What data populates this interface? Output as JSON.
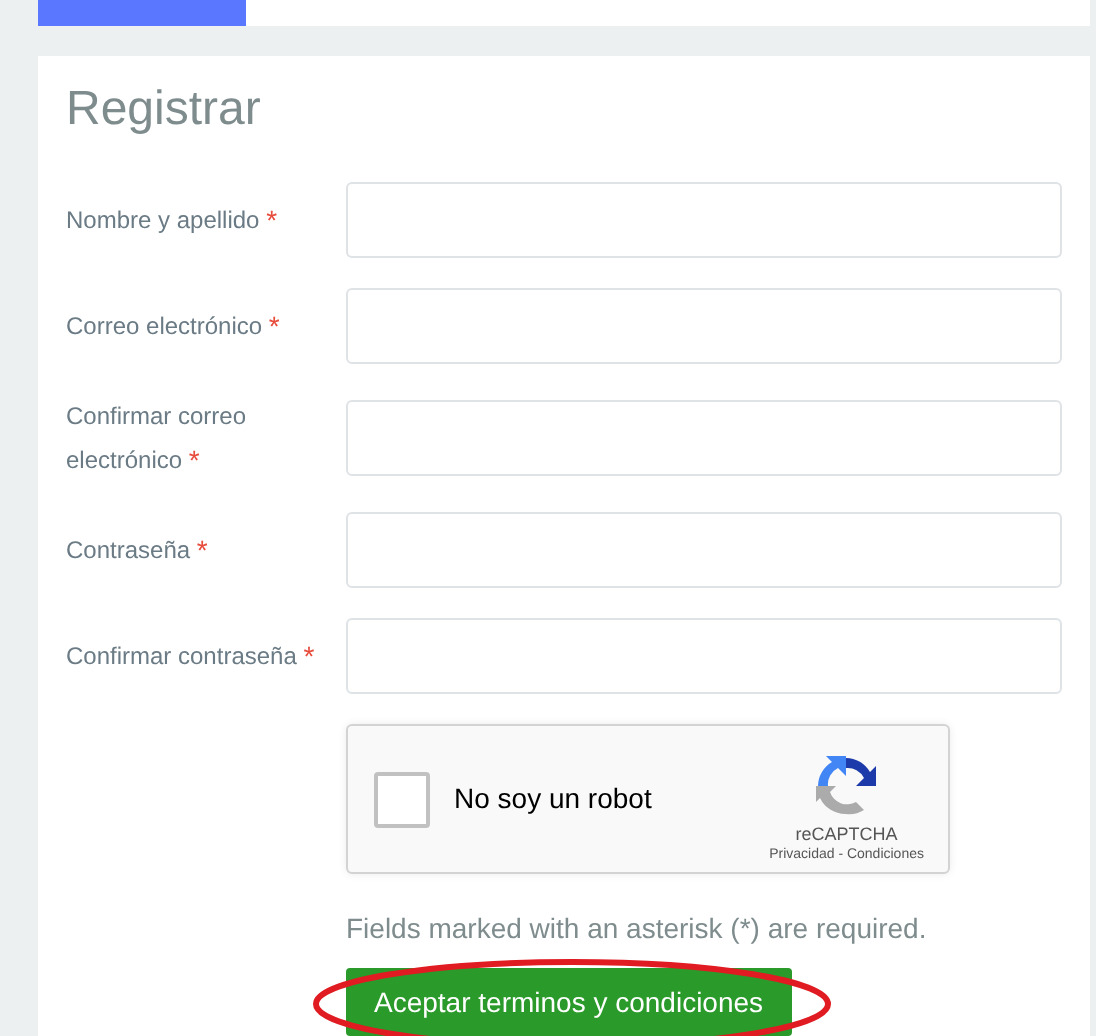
{
  "title": "Registrar",
  "fields": [
    {
      "label": "Nombre y apellido",
      "required_mark": "*"
    },
    {
      "label": "Correo electrónico",
      "required_mark": "*"
    },
    {
      "label": "Confirmar correo electrónico",
      "required_mark": "*"
    },
    {
      "label": "Contraseña",
      "required_mark": "*"
    },
    {
      "label": "Confirmar contraseña",
      "required_mark": "*"
    }
  ],
  "captcha": {
    "label": "No soy un robot",
    "checked": false,
    "brand": "reCAPTCHA",
    "links": "Privacidad - Condiciones"
  },
  "note": "Fields marked with an asterisk (*) are required.",
  "submit_button": {
    "label": "Aceptar terminos y condiciones",
    "circled": true
  }
}
